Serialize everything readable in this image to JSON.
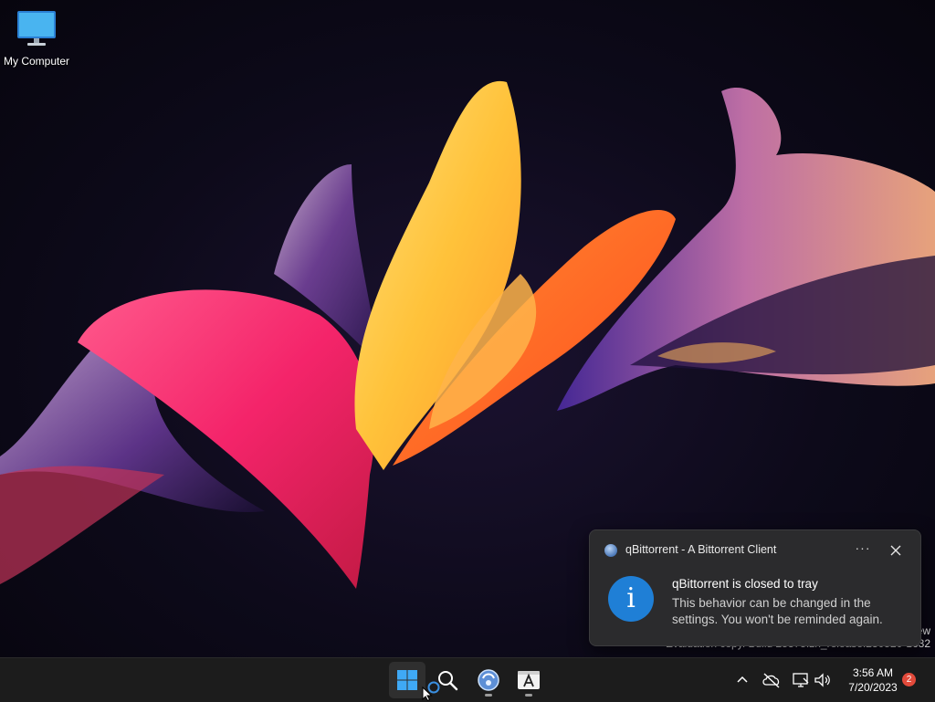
{
  "desktop": {
    "icons": [
      {
        "label": "My Computer",
        "icon": "monitor-icon"
      }
    ]
  },
  "watermark": {
    "line1": "ew",
    "line2": "Evaluation copy. Build 25375.zn_release.230520-1632"
  },
  "toast": {
    "app_name": "qBittorrent - A Bittorrent Client",
    "title": "qBittorrent is closed to tray",
    "body": "This behavior can be changed in the settings. You won't be reminded again.",
    "more_label": "···",
    "icon": "info-icon"
  },
  "taskbar": {
    "apps": [
      {
        "name": "start",
        "icon": "windows-logo-icon"
      },
      {
        "name": "search",
        "icon": "search-icon"
      },
      {
        "name": "qbittorrent",
        "icon": "qbittorrent-icon"
      },
      {
        "name": "app-store",
        "icon": "store-icon"
      }
    ],
    "tray": {
      "icons": [
        "chevron-up-icon",
        "cloud-offline-icon",
        "network-icon",
        "volume-icon"
      ],
      "time": "3:56 AM",
      "date": "7/20/2023",
      "notification_count": "2"
    }
  },
  "colors": {
    "accent": "#1f7fd6",
    "taskbar": "#1c1c1c",
    "toast_bg": "#2b2b2d",
    "badge": "#e24a3b"
  }
}
